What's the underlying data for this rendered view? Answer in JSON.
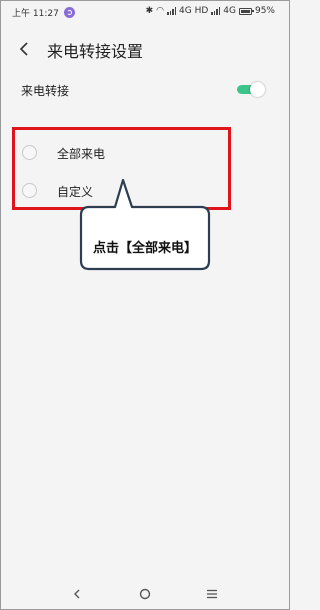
{
  "status_bar": {
    "time_label": "上午 11:27",
    "network_1": "4G HD",
    "network_2": "4G",
    "battery_percent": "95%"
  },
  "header": {
    "title": "来电转接设置"
  },
  "forward_setting": {
    "label": "来电转接",
    "enabled": true
  },
  "options": [
    {
      "label": "全部来电",
      "selected": false
    },
    {
      "label": "自定义",
      "selected": false
    }
  ],
  "annotation": {
    "callout_text": "点击【全部来电】",
    "highlight_color": "#e0151c",
    "callout_border_color": "#2c3e50"
  },
  "colors": {
    "toggle_on": "#3cc48a",
    "background": "#f4f4f4"
  },
  "nav_bar": {
    "icons": [
      "back-icon",
      "home-icon",
      "menu-icon"
    ]
  }
}
